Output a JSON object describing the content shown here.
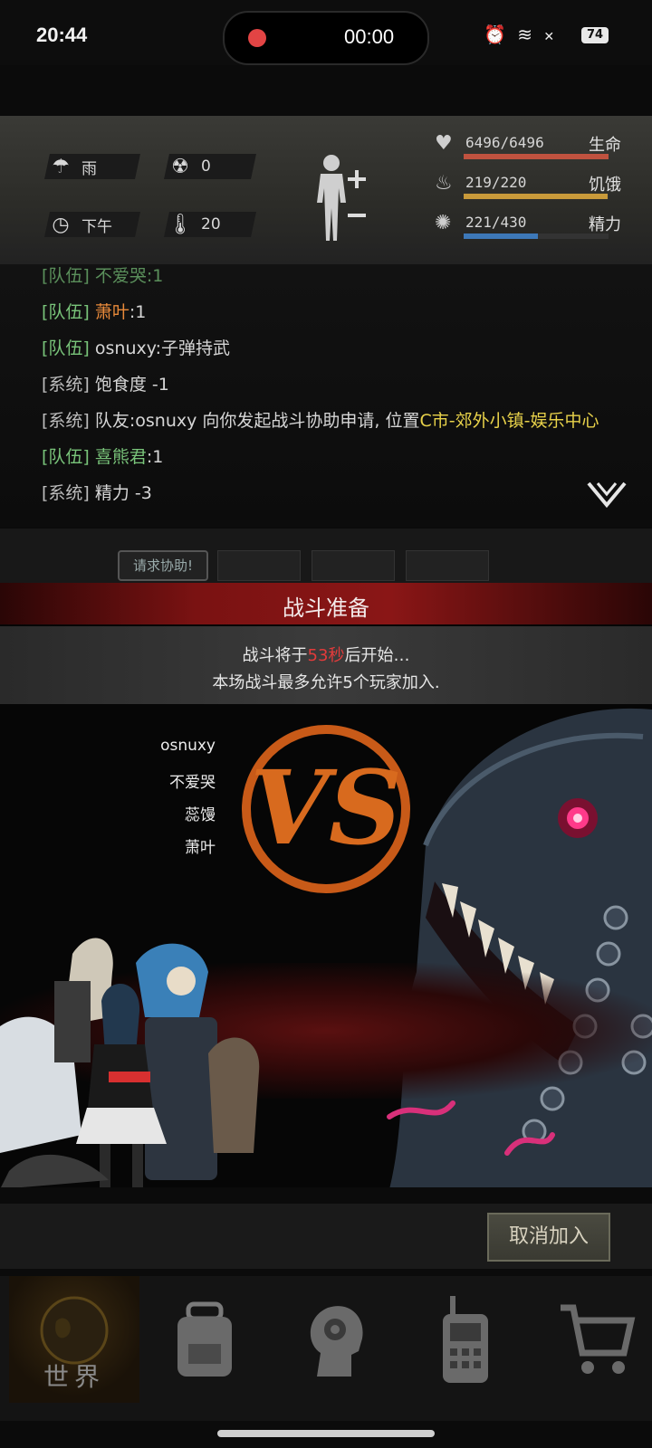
{
  "status": {
    "time": "20:44",
    "record_time": "00:00",
    "battery": "74"
  },
  "env": {
    "weather": "雨",
    "radiation": "0",
    "time_of_day": "下午",
    "temperature": "20"
  },
  "vitals": [
    {
      "label": "生命",
      "value": "6496/6496",
      "fill": 1.0,
      "color": "#c0523f"
    },
    {
      "label": "饥饿",
      "value": "219/220",
      "fill": 0.995,
      "color": "#c99a3a"
    },
    {
      "label": "精力",
      "value": "221/430",
      "fill": 0.514,
      "color": "#3d78b8"
    }
  ],
  "chat": {
    "partial": "[队伍] 不爱哭:1",
    "lines": [
      {
        "tag": "[队伍]",
        "name": "萧叶",
        "text": ":1"
      },
      {
        "tag": "[队伍]",
        "name": "osnuxy",
        "text": ":子弹持武"
      },
      {
        "tag": "[系统]",
        "text": "饱食度 -1"
      },
      {
        "tag": "[系统]",
        "text": "队友:osnuxy 向你发起战斗协助申请, 位置",
        "location": "C市-郊外小镇-娱乐中心"
      },
      {
        "tag": "[队伍]",
        "name": "喜熊君",
        "text": ":1"
      },
      {
        "tag": "[系统]",
        "text": "精力 -3"
      }
    ]
  },
  "request_help": "请求协助!",
  "battle": {
    "title": "战斗准备",
    "line1_pre": "战斗将于",
    "seconds": "53秒",
    "line1_post": "后开始…",
    "line2": "本场战斗最多允许5个玩家加入.",
    "vs": "VS",
    "players": [
      "osnuxy",
      "不爱哭",
      "蕊馒",
      "萧叶"
    ]
  },
  "cancel_label": "取消加入",
  "nav": {
    "world_label": "世界"
  }
}
